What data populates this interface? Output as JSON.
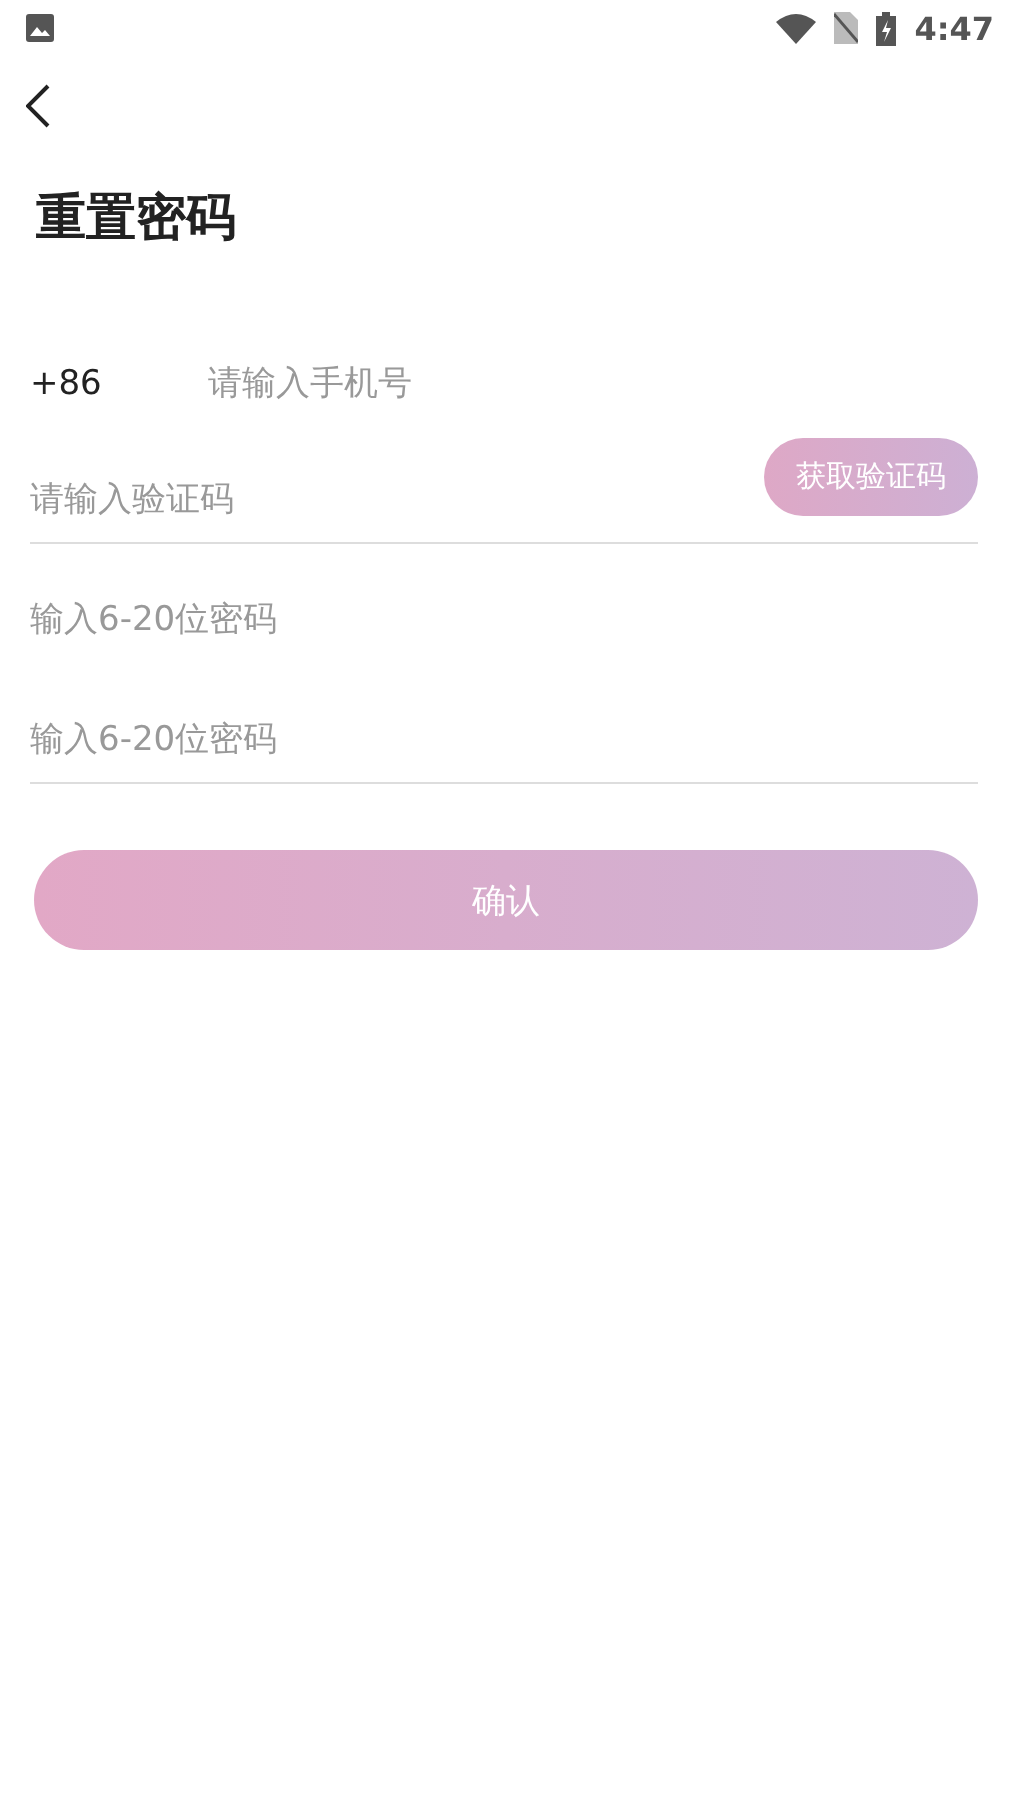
{
  "status_bar": {
    "time": "4:47"
  },
  "title": "重置密码",
  "phone": {
    "prefix": "+86",
    "placeholder": "请输入手机号"
  },
  "fields": [
    {
      "kind": "code",
      "placeholder": "请输入验证码",
      "underline": true,
      "button": "获取验证码"
    },
    {
      "kind": "password",
      "placeholder": "输入6-20位密码",
      "underline": false
    },
    {
      "kind": "password",
      "placeholder": "输入6-20位密码",
      "underline": true
    }
  ],
  "confirm_button": "确认"
}
